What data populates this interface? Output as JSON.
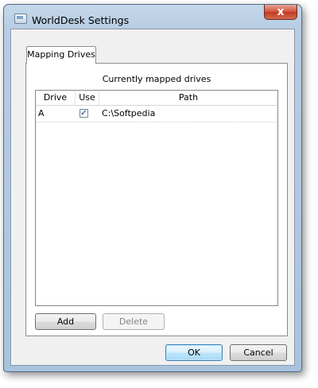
{
  "window": {
    "title": "WorldDesk Settings",
    "close_label": "x"
  },
  "tabs": [
    {
      "label": "Mapping Drives",
      "active": true
    }
  ],
  "mapping": {
    "section_label": "Currently mapped drives",
    "columns": [
      "Drive",
      "Use",
      "Path"
    ],
    "rows": [
      {
        "drive": "A",
        "use": true,
        "use_mark": "✓",
        "path": "C:\\Softpedia"
      }
    ],
    "add_label": "Add",
    "delete_label": "Delete"
  },
  "footer": {
    "ok_label": "OK",
    "cancel_label": "Cancel"
  }
}
